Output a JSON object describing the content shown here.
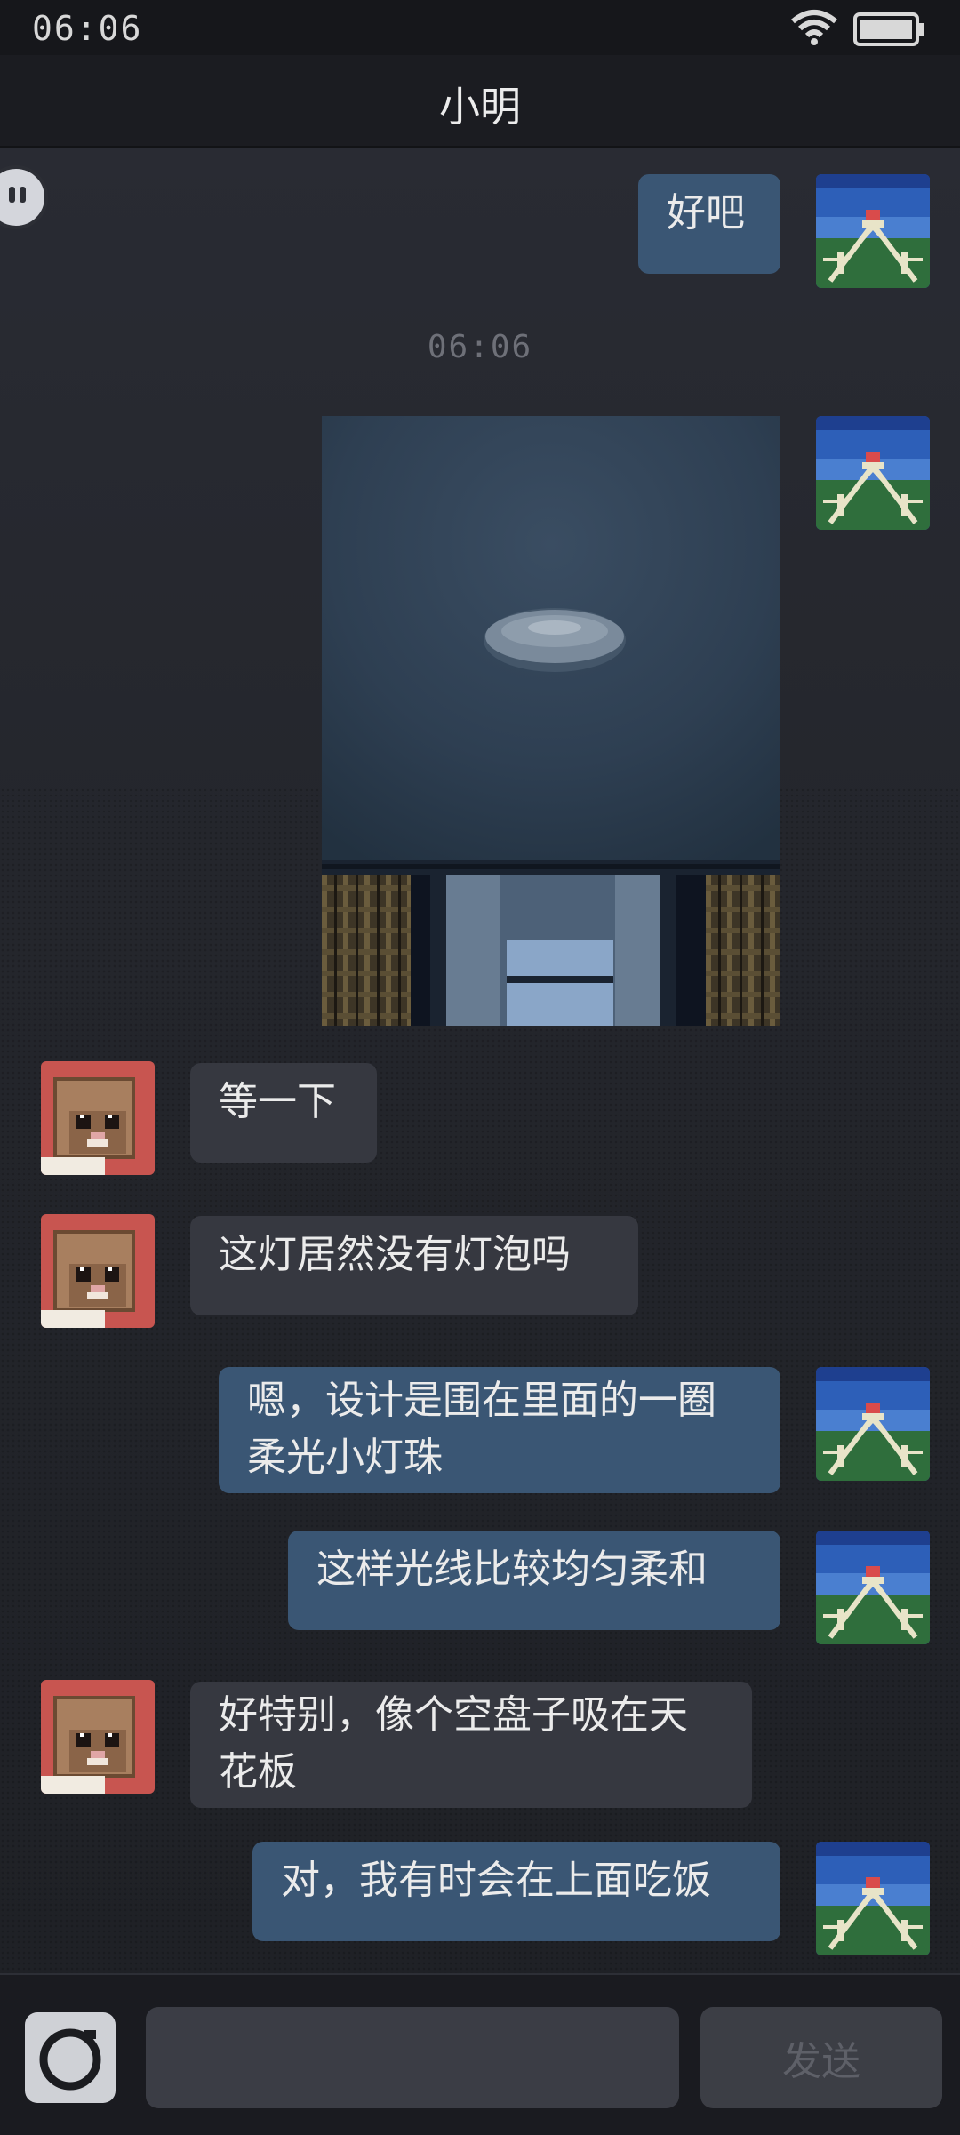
{
  "status": {
    "time": "06:06"
  },
  "header": {
    "title": "小明"
  },
  "messages": [
    {
      "side": "me",
      "text": "好吧"
    },
    {
      "side": "me",
      "type": "image",
      "image_name": "ceiling-lamp-photo"
    },
    {
      "side": "other",
      "text": "等一下"
    },
    {
      "side": "other",
      "text": "这灯居然没有灯泡吗"
    },
    {
      "side": "me",
      "text": "嗯，设计是围在里面的一圈柔光小灯珠"
    },
    {
      "side": "me",
      "text": "这样光线比较均匀柔和"
    },
    {
      "side": "other",
      "text": "好特别，像个空盘子吸在天花板"
    },
    {
      "side": "me",
      "text": "对，我有时会在上面吃饭"
    }
  ],
  "timestamp": "06:06",
  "composer": {
    "input_value": "",
    "input_placeholder": "",
    "send_label": "发送"
  },
  "icons": {
    "wifi": "wifi-icon",
    "battery": "battery-icon",
    "camera": "camera-icon",
    "assistant": "assistant-bot-icon",
    "my_avatar": "pixel-landscape-avatar",
    "other_avatar": "pixel-cat-avatar"
  },
  "colors": {
    "my_bubble": "#3a5674",
    "other_bubble": "#363840",
    "background": "#24262d",
    "header": "#1b1c21"
  }
}
